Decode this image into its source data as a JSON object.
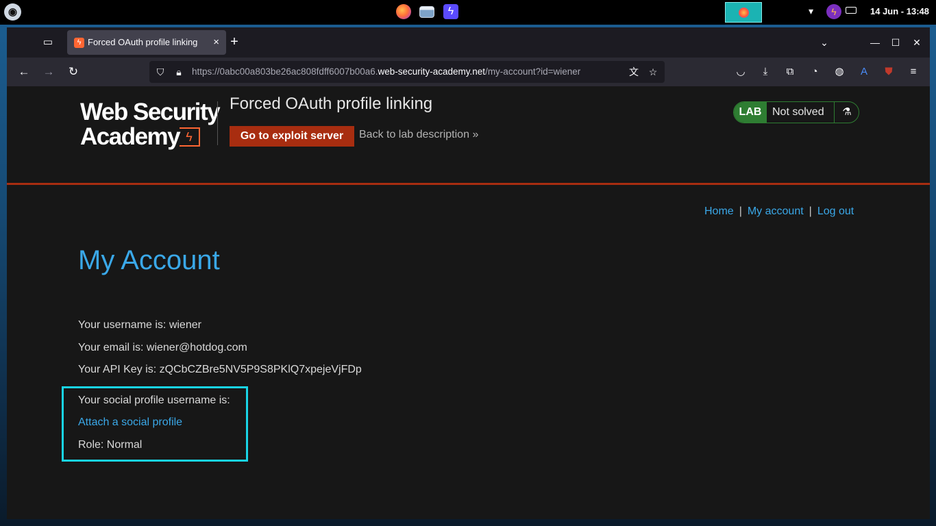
{
  "os": {
    "logo_icon": "kali-dragon-icon",
    "clock": "14 Jun - 13:48"
  },
  "browser": {
    "tab_title": "Forced OAuth profile linking",
    "tab_close": "×",
    "new_tab": "+",
    "url_prefix": "https://0abc00a803be26ac808fdff6007b00a6.",
    "url_host": "web-security-academy.net",
    "url_path": "/my-account?id=wiener"
  },
  "lab": {
    "logo_line1": "Web Security",
    "logo_line2": "Academy",
    "title": "Forced OAuth profile linking",
    "exploit_button": "Go to exploit server",
    "back_link": "Back to lab description",
    "back_chevron": "»",
    "badge": "LAB",
    "status": "Not solved"
  },
  "nav": {
    "home": "Home",
    "sep": "|",
    "my_account": "My account",
    "log_out": "Log out"
  },
  "account": {
    "heading": "My Account",
    "username_line": "Your username is: wiener",
    "email_line": "Your email is: wiener@hotdog.com",
    "api_key_line": "Your API Key is: zQCbCZBre5NV5P9S8PKlQ7xpejeVjFDp",
    "social_line": "Your social profile username is:",
    "attach_link": "Attach a social profile",
    "role_line": "Role: Normal"
  },
  "colors": {
    "accent_blue": "#3aa8e8",
    "brand_orange": "#ff6633",
    "exploit_red": "#a82d10",
    "lab_green": "#2e7d32",
    "highlight_cyan": "#19d4e6"
  }
}
